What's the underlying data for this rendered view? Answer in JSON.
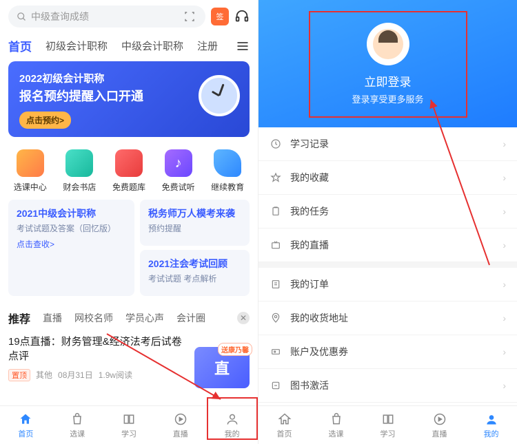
{
  "left": {
    "search_placeholder": "中级查询成绩",
    "calendar_label": "签",
    "tabs": [
      "首页",
      "初级会计职称",
      "中级会计职称",
      "注册"
    ],
    "banner": {
      "line1": "2022初级会计职称",
      "line2": "报名预约提醒入口开通",
      "button": "点击预约>"
    },
    "quick": [
      {
        "label": "选课中心"
      },
      {
        "label": "财会书店"
      },
      {
        "label": "免费题库"
      },
      {
        "label": "免费试听"
      },
      {
        "label": "继续教育"
      }
    ],
    "cards": {
      "left": {
        "title": "2021中级会计职称",
        "sub": "考试试题及答案（回忆版）",
        "link": "点击查收>"
      },
      "r1": {
        "title": "税务师万人模考来袭",
        "sub": "预约提醒"
      },
      "r2": {
        "title": "2021注会考试回顾",
        "sub": "考试试题 考点解析"
      }
    },
    "rec_tabs": [
      "推荐",
      "直播",
      "网校名师",
      "学员心声",
      "会计圈"
    ],
    "article": {
      "title": "19点直播：财务管理&经济法考后试卷点评",
      "top_tag": "置顶",
      "meta_author": "其他",
      "meta_date": "08月31日",
      "meta_reads": "1.9w阅读",
      "thumb_text": "直",
      "thumb_badge": "送康乃馨"
    },
    "tabbar": [
      "首页",
      "选课",
      "学习",
      "直播",
      "我的"
    ]
  },
  "right": {
    "login_text": "立即登录",
    "login_sub": "登录享受更多服务",
    "menu1": [
      "学习记录",
      "我的收藏",
      "我的任务",
      "我的直播"
    ],
    "menu2": [
      "我的订单",
      "我的收货地址",
      "账户及优惠券",
      "图书激活"
    ],
    "tabbar": [
      "首页",
      "选课",
      "学习",
      "直播",
      "我的"
    ]
  }
}
